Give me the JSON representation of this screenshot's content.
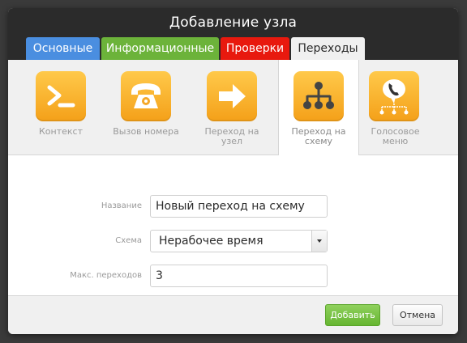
{
  "dialog": {
    "title": "Добавление узла"
  },
  "tabs": [
    {
      "label": "Основные",
      "color": "#4a8ee0"
    },
    {
      "label": "Информационные",
      "color": "#6cb33a"
    },
    {
      "label": "Проверки",
      "color": "#e8190e"
    },
    {
      "label": "Переходы",
      "active": true
    }
  ],
  "node_types": [
    {
      "label": "Контекст",
      "icon": "context-prompt-icon"
    },
    {
      "label": "Вызов номера",
      "icon": "telephone-icon"
    },
    {
      "label": "Переход на узел",
      "icon": "arrow-right-icon"
    },
    {
      "label": "Переход на схему",
      "icon": "hierarchy-scheme-icon",
      "selected": true
    },
    {
      "label": "Голосовое меню",
      "icon": "voice-menu-icon"
    }
  ],
  "form": {
    "name_label": "Название",
    "name_value": "Новый переход на схему",
    "scheme_label": "Схема",
    "scheme_value": "Нерабочее время",
    "max_label": "Макс. переходов",
    "max_value": "3"
  },
  "buttons": {
    "add": "Добавить",
    "cancel": "Отмена"
  },
  "colors": {
    "accent_tile": "#f4a019",
    "add_button": "#66b531"
  }
}
